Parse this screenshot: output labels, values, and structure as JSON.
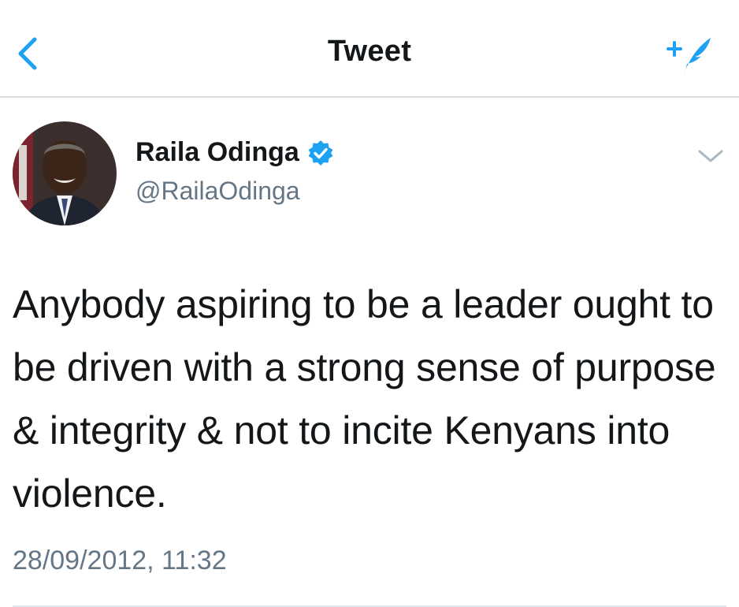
{
  "header": {
    "title": "Tweet",
    "back_icon": "chevron-left-icon",
    "compose_icon": "compose-tweet-icon"
  },
  "tweet": {
    "author": {
      "name": "Raila Odinga",
      "handle": "@RailaOdinga",
      "verified": true
    },
    "text": "Anybody aspiring to be a leader ought to be driven with a strong sense of purpose & integrity & not to incite Kenyans into violence.",
    "timestamp": "28/09/2012, 11:32"
  },
  "colors": {
    "accent": "#1da1f2",
    "text_primary": "#14171a",
    "text_secondary": "#657786",
    "divider": "#e1e8ed"
  }
}
